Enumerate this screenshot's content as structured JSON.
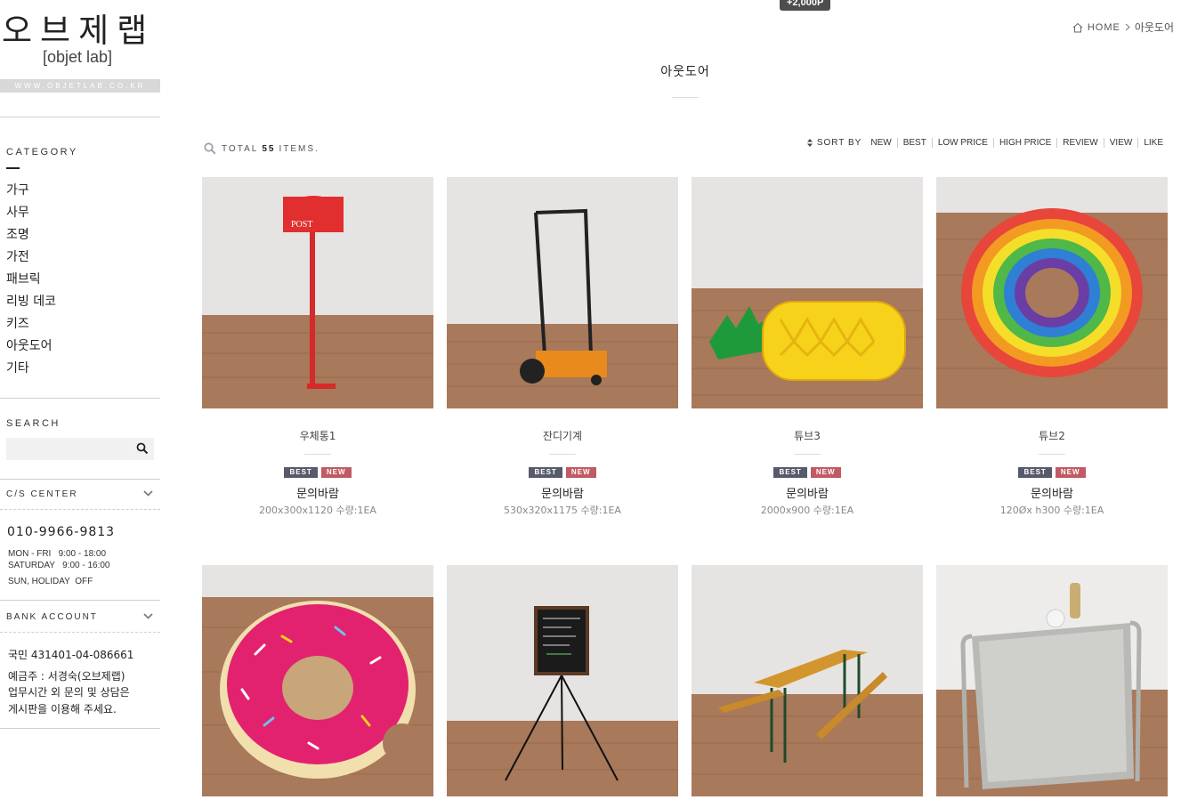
{
  "logo": {
    "korean": "오브제랩",
    "english": "[objet lab]",
    "url": "WWW.OBJETLAB.CO.KR"
  },
  "badge_points": "+2,000P",
  "breadcrumb": {
    "home": "HOME",
    "current": "아웃도어"
  },
  "page_title": "아웃도어",
  "sidebar": {
    "category_title": "CATEGORY",
    "categories": [
      "가구",
      "사무",
      "조명",
      "가전",
      "패브릭",
      "리빙 데코",
      "키즈",
      "아웃도어",
      "기타"
    ],
    "search_title": "SEARCH",
    "search_value": "",
    "cs_title": "C/S CENTER",
    "phone": "010-9966-9813",
    "hours": [
      "MON - FRI   9:00 - 18:00",
      "SATURDAY   9:00 - 16:00",
      "SUN, HOLIDAY  OFF"
    ],
    "bank_title": "BANK ACCOUNT",
    "bank_account": "국민 431401-04-086661",
    "bank_holder": "예금주 : 서경숙(오브제랩)",
    "bank_note_1": "업무시간 외 문의 및 상담은",
    "bank_note_2": "게시판을 이용해 주세요."
  },
  "toolbar": {
    "total_prefix": "TOTAL",
    "total_count": "55",
    "total_suffix": "ITEMS.",
    "sort_label": "SORT BY",
    "sort_options": [
      "NEW",
      "BEST",
      "LOW PRICE",
      "HIGH PRICE",
      "REVIEW",
      "VIEW",
      "LIKE"
    ]
  },
  "products": [
    {
      "name": "우체통1",
      "tags": [
        "BEST",
        "NEW"
      ],
      "price": "문의바람",
      "spec": "200x300x1120 수량:1EA",
      "image": "red mailbox"
    },
    {
      "name": "잔디기계",
      "tags": [
        "BEST",
        "NEW"
      ],
      "price": "문의바람",
      "spec": "530x320x1175 수량:1EA",
      "image": "lawn mower"
    },
    {
      "name": "튜브3",
      "tags": [
        "BEST",
        "NEW"
      ],
      "price": "문의바람",
      "spec": "2000x900 수량:1EA",
      "image": "pineapple float"
    },
    {
      "name": "튜브2",
      "tags": [
        "BEST",
        "NEW"
      ],
      "price": "문의바람",
      "spec": "120Øx h300 수량:1EA",
      "image": "rainbow ring"
    },
    {
      "name": "",
      "image": "donut float"
    },
    {
      "name": "",
      "image": "chalkboard easel"
    },
    {
      "name": "",
      "image": "picnic table"
    },
    {
      "name": "",
      "image": "display stand"
    }
  ],
  "colors": {
    "tag_best": "#565a6a",
    "tag_new": "#c05b63",
    "floor": "#a0714f",
    "wall": "#e6e4e2"
  }
}
